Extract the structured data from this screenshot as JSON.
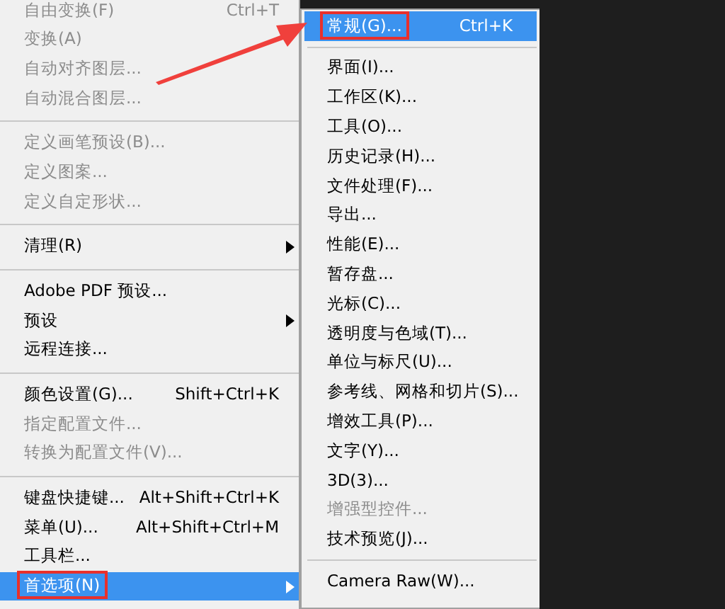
{
  "edit_menu": {
    "items": [
      {
        "kind": "item",
        "label": "自由变换(F)",
        "shortcut": "Ctrl+T",
        "disabled": true,
        "selected": false
      },
      {
        "kind": "item",
        "label": "变换(A)",
        "disabled": true,
        "selected": false
      },
      {
        "kind": "item",
        "label": "自动对齐图层...",
        "disabled": true,
        "selected": false
      },
      {
        "kind": "item",
        "label": "自动混合图层...",
        "disabled": true,
        "selected": false
      },
      {
        "kind": "separator"
      },
      {
        "kind": "item",
        "label": "定义画笔预设(B)...",
        "disabled": true,
        "selected": false
      },
      {
        "kind": "item",
        "label": "定义图案...",
        "disabled": true,
        "selected": false
      },
      {
        "kind": "item",
        "label": "定义自定形状...",
        "disabled": true,
        "selected": false
      },
      {
        "kind": "separator"
      },
      {
        "kind": "submenu",
        "label": "清理(R)",
        "disabled": false,
        "selected": false
      },
      {
        "kind": "separator"
      },
      {
        "kind": "item",
        "label": "Adobe PDF 预设...",
        "disabled": false,
        "selected": false
      },
      {
        "kind": "submenu",
        "label": "预设",
        "disabled": false,
        "selected": false
      },
      {
        "kind": "item",
        "label": "远程连接...",
        "disabled": false,
        "selected": false
      },
      {
        "kind": "separator"
      },
      {
        "kind": "item",
        "label": "颜色设置(G)...",
        "shortcut": "Shift+Ctrl+K",
        "disabled": false,
        "selected": false
      },
      {
        "kind": "item",
        "label": "指定配置文件...",
        "disabled": true,
        "selected": false
      },
      {
        "kind": "item",
        "label": "转换为配置文件(V)...",
        "disabled": true,
        "selected": false
      },
      {
        "kind": "separator"
      },
      {
        "kind": "item",
        "label": "键盘快捷键...",
        "shortcut": "Alt+Shift+Ctrl+K",
        "disabled": false,
        "selected": false
      },
      {
        "kind": "item",
        "label": "菜单(U)...",
        "shortcut": "Alt+Shift+Ctrl+M",
        "disabled": false,
        "selected": false
      },
      {
        "kind": "item",
        "label": "工具栏...",
        "disabled": false,
        "selected": false
      },
      {
        "kind": "submenu",
        "label": "首选项(N)",
        "disabled": false,
        "selected": true,
        "boxed": true
      }
    ]
  },
  "preferences_menu": {
    "items": [
      {
        "kind": "item",
        "label": "常规(G)...",
        "shortcut": "Ctrl+K",
        "disabled": false,
        "selected": true,
        "boxed": true
      },
      {
        "kind": "separator"
      },
      {
        "kind": "item",
        "label": "界面(I)...",
        "disabled": false,
        "selected": false
      },
      {
        "kind": "item",
        "label": "工作区(K)...",
        "disabled": false,
        "selected": false
      },
      {
        "kind": "item",
        "label": "工具(O)...",
        "disabled": false,
        "selected": false
      },
      {
        "kind": "item",
        "label": "历史记录(H)...",
        "disabled": false,
        "selected": false
      },
      {
        "kind": "item",
        "label": "文件处理(F)...",
        "disabled": false,
        "selected": false
      },
      {
        "kind": "item",
        "label": "导出...",
        "disabled": false,
        "selected": false
      },
      {
        "kind": "item",
        "label": "性能(E)...",
        "disabled": false,
        "selected": false
      },
      {
        "kind": "item",
        "label": "暂存盘...",
        "disabled": false,
        "selected": false
      },
      {
        "kind": "item",
        "label": "光标(C)...",
        "disabled": false,
        "selected": false
      },
      {
        "kind": "item",
        "label": "透明度与色域(T)...",
        "disabled": false,
        "selected": false
      },
      {
        "kind": "item",
        "label": "单位与标尺(U)...",
        "disabled": false,
        "selected": false
      },
      {
        "kind": "item",
        "label": "参考线、网格和切片(S)...",
        "disabled": false,
        "selected": false
      },
      {
        "kind": "item",
        "label": "增效工具(P)...",
        "disabled": false,
        "selected": false
      },
      {
        "kind": "item",
        "label": "文字(Y)...",
        "disabled": false,
        "selected": false
      },
      {
        "kind": "item",
        "label": "3D(3)...",
        "disabled": false,
        "selected": false
      },
      {
        "kind": "item",
        "label": "增强型控件...",
        "disabled": true,
        "selected": false
      },
      {
        "kind": "item",
        "label": "技术预览(J)...",
        "disabled": false,
        "selected": false
      },
      {
        "kind": "separator"
      },
      {
        "kind": "item",
        "label": "Camera Raw(W)...",
        "disabled": false,
        "selected": false
      }
    ]
  },
  "annotations": [
    {
      "kind": "arrow",
      "color": "#f0403c"
    }
  ]
}
